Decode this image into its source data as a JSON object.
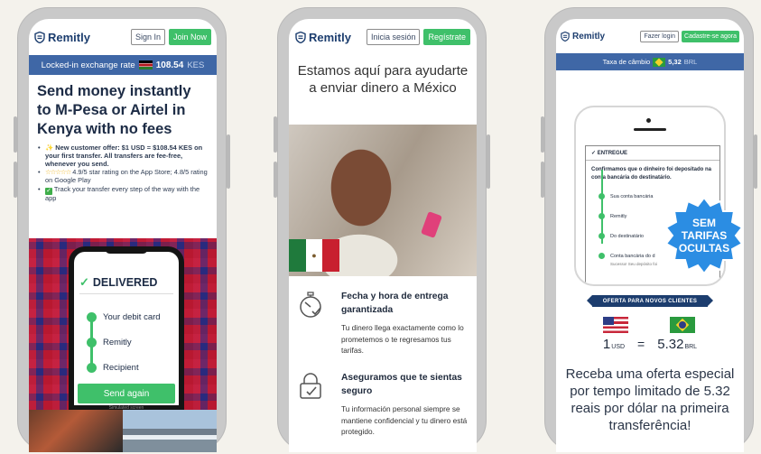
{
  "brand": "Remitly",
  "phone1": {
    "signin": "Sign In",
    "join": "Join Now",
    "rate_label": "Locked-in exchange rate",
    "rate_value": "108.54",
    "rate_currency": "KES",
    "headline": "Send money instantly to M-Pesa or Airtel in Kenya with no fees",
    "bullet1": "✨ New customer offer: $1 USD = $108.54 KES on your first transfer. All transfers are fee-free, whenever you send.",
    "bullet2_stars": "☆☆☆☆☆",
    "bullet2": "4.9/5 star rating on the App Store; 4.8/5 rating on Google Play",
    "bullet3": "Track your transfer every step of the way with the app",
    "delivered": "DELIVERED",
    "step1": "Your debit card",
    "step2": "Remitly",
    "step3": "Recipient",
    "send_again": "Send again",
    "simulated": "Simulated screen"
  },
  "phone2": {
    "signin": "Inicia sesión",
    "register": "Regístrate",
    "headline": "Estamos aquí para ayudarte a enviar dinero a México",
    "feat1_title": "Fecha y hora de entrega garantizada",
    "feat1_desc": "Tu dinero llega exactamente como lo prometemos o te regresamos tus tarifas.",
    "feat2_title": "Aseguramos que te sientas seguro",
    "feat2_desc": "Tu información personal siempre se mantiene confidencial y tu dinero está protegido."
  },
  "phone3": {
    "login": "Fazer login",
    "register": "Cadastre-se agora",
    "rate_label": "Taxa de câmbio",
    "rate_value": "5,32",
    "rate_currency": "BRL",
    "entregue": "ENTREGUE",
    "confirm": "Confirmamos que o dinheiro foi depositado na conta bancária do destinatário.",
    "s1": "Sua conta bancária",
    "s2": "Remitly",
    "s3": "Do destinatário",
    "s4": "Conta bancária do d",
    "s4b": "Sucesso! Seu depósito foi",
    "badge1": "SEM",
    "badge2": "TARIFAS",
    "badge3": "OCULTAS",
    "ribbon": "OFERTA PARA NOVOS CLIENTES",
    "from_amount": "1",
    "from_currency": "USD",
    "equals": "=",
    "to_amount": "5.32",
    "to_currency": "BRL",
    "offer": "Receba uma oferta especial por tempo limitado de 5.32 reais por dólar na primeira transferência!"
  },
  "colors": {
    "brand_blue": "#1c3d6e",
    "green": "#3fc06a",
    "rate_bar": "#3f67a6"
  }
}
